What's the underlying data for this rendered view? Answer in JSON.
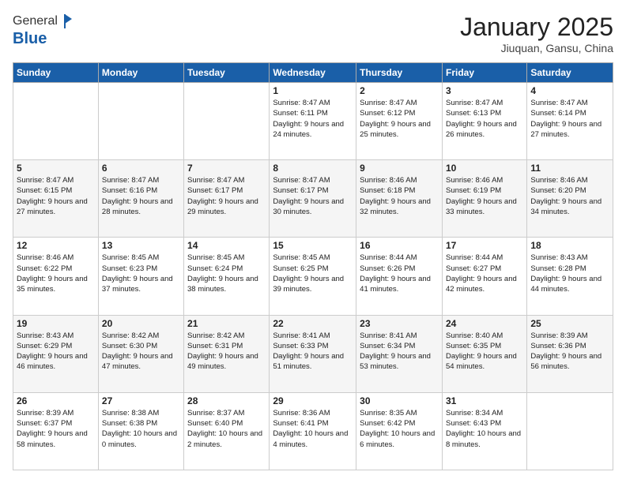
{
  "logo": {
    "general": "General",
    "blue": "Blue"
  },
  "header": {
    "month": "January 2025",
    "location": "Jiuquan, Gansu, China"
  },
  "days_of_week": [
    "Sunday",
    "Monday",
    "Tuesday",
    "Wednesday",
    "Thursday",
    "Friday",
    "Saturday"
  ],
  "weeks": [
    [
      {
        "day": "",
        "info": ""
      },
      {
        "day": "",
        "info": ""
      },
      {
        "day": "",
        "info": ""
      },
      {
        "day": "1",
        "info": "Sunrise: 8:47 AM\nSunset: 6:11 PM\nDaylight: 9 hours\nand 24 minutes."
      },
      {
        "day": "2",
        "info": "Sunrise: 8:47 AM\nSunset: 6:12 PM\nDaylight: 9 hours\nand 25 minutes."
      },
      {
        "day": "3",
        "info": "Sunrise: 8:47 AM\nSunset: 6:13 PM\nDaylight: 9 hours\nand 26 minutes."
      },
      {
        "day": "4",
        "info": "Sunrise: 8:47 AM\nSunset: 6:14 PM\nDaylight: 9 hours\nand 27 minutes."
      }
    ],
    [
      {
        "day": "5",
        "info": "Sunrise: 8:47 AM\nSunset: 6:15 PM\nDaylight: 9 hours\nand 27 minutes."
      },
      {
        "day": "6",
        "info": "Sunrise: 8:47 AM\nSunset: 6:16 PM\nDaylight: 9 hours\nand 28 minutes."
      },
      {
        "day": "7",
        "info": "Sunrise: 8:47 AM\nSunset: 6:17 PM\nDaylight: 9 hours\nand 29 minutes."
      },
      {
        "day": "8",
        "info": "Sunrise: 8:47 AM\nSunset: 6:17 PM\nDaylight: 9 hours\nand 30 minutes."
      },
      {
        "day": "9",
        "info": "Sunrise: 8:46 AM\nSunset: 6:18 PM\nDaylight: 9 hours\nand 32 minutes."
      },
      {
        "day": "10",
        "info": "Sunrise: 8:46 AM\nSunset: 6:19 PM\nDaylight: 9 hours\nand 33 minutes."
      },
      {
        "day": "11",
        "info": "Sunrise: 8:46 AM\nSunset: 6:20 PM\nDaylight: 9 hours\nand 34 minutes."
      }
    ],
    [
      {
        "day": "12",
        "info": "Sunrise: 8:46 AM\nSunset: 6:22 PM\nDaylight: 9 hours\nand 35 minutes."
      },
      {
        "day": "13",
        "info": "Sunrise: 8:45 AM\nSunset: 6:23 PM\nDaylight: 9 hours\nand 37 minutes."
      },
      {
        "day": "14",
        "info": "Sunrise: 8:45 AM\nSunset: 6:24 PM\nDaylight: 9 hours\nand 38 minutes."
      },
      {
        "day": "15",
        "info": "Sunrise: 8:45 AM\nSunset: 6:25 PM\nDaylight: 9 hours\nand 39 minutes."
      },
      {
        "day": "16",
        "info": "Sunrise: 8:44 AM\nSunset: 6:26 PM\nDaylight: 9 hours\nand 41 minutes."
      },
      {
        "day": "17",
        "info": "Sunrise: 8:44 AM\nSunset: 6:27 PM\nDaylight: 9 hours\nand 42 minutes."
      },
      {
        "day": "18",
        "info": "Sunrise: 8:43 AM\nSunset: 6:28 PM\nDaylight: 9 hours\nand 44 minutes."
      }
    ],
    [
      {
        "day": "19",
        "info": "Sunrise: 8:43 AM\nSunset: 6:29 PM\nDaylight: 9 hours\nand 46 minutes."
      },
      {
        "day": "20",
        "info": "Sunrise: 8:42 AM\nSunset: 6:30 PM\nDaylight: 9 hours\nand 47 minutes."
      },
      {
        "day": "21",
        "info": "Sunrise: 8:42 AM\nSunset: 6:31 PM\nDaylight: 9 hours\nand 49 minutes."
      },
      {
        "day": "22",
        "info": "Sunrise: 8:41 AM\nSunset: 6:33 PM\nDaylight: 9 hours\nand 51 minutes."
      },
      {
        "day": "23",
        "info": "Sunrise: 8:41 AM\nSunset: 6:34 PM\nDaylight: 9 hours\nand 53 minutes."
      },
      {
        "day": "24",
        "info": "Sunrise: 8:40 AM\nSunset: 6:35 PM\nDaylight: 9 hours\nand 54 minutes."
      },
      {
        "day": "25",
        "info": "Sunrise: 8:39 AM\nSunset: 6:36 PM\nDaylight: 9 hours\nand 56 minutes."
      }
    ],
    [
      {
        "day": "26",
        "info": "Sunrise: 8:39 AM\nSunset: 6:37 PM\nDaylight: 9 hours\nand 58 minutes."
      },
      {
        "day": "27",
        "info": "Sunrise: 8:38 AM\nSunset: 6:38 PM\nDaylight: 10 hours\nand 0 minutes."
      },
      {
        "day": "28",
        "info": "Sunrise: 8:37 AM\nSunset: 6:40 PM\nDaylight: 10 hours\nand 2 minutes."
      },
      {
        "day": "29",
        "info": "Sunrise: 8:36 AM\nSunset: 6:41 PM\nDaylight: 10 hours\nand 4 minutes."
      },
      {
        "day": "30",
        "info": "Sunrise: 8:35 AM\nSunset: 6:42 PM\nDaylight: 10 hours\nand 6 minutes."
      },
      {
        "day": "31",
        "info": "Sunrise: 8:34 AM\nSunset: 6:43 PM\nDaylight: 10 hours\nand 8 minutes."
      },
      {
        "day": "",
        "info": ""
      }
    ]
  ]
}
